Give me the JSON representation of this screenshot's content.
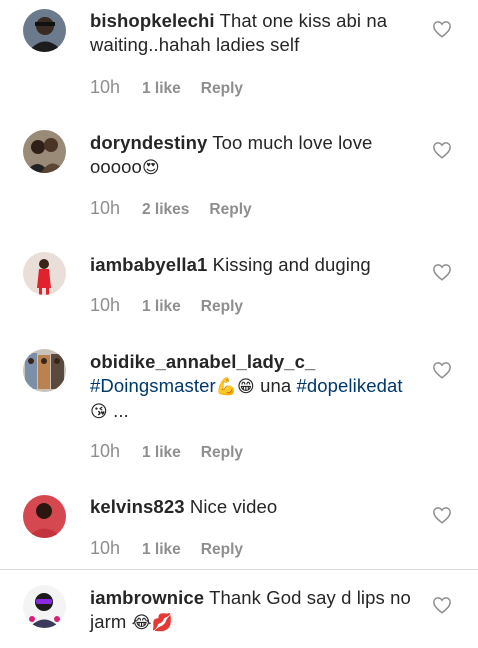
{
  "comments": [
    {
      "username": "bishopkelechi",
      "text": "That one kiss abi na waiting..hahah ladies self",
      "time": "10h",
      "likes": "1 like",
      "reply": "Reply"
    },
    {
      "username": "doryndestiny",
      "text": "Too much love love ooooo",
      "emoji": "😍",
      "time": "10h",
      "likes": "2 likes",
      "reply": "Reply"
    },
    {
      "username": "iambabyella1",
      "text": "Kissing and duging",
      "time": "10h",
      "likes": "1 like",
      "reply": "Reply"
    },
    {
      "username": "obidike_annabel_lady_c_",
      "hashtag1": "#Doingsmaster",
      "emoji1": "💪😁",
      "mid": "una",
      "hashtag2": "#dopelikedat",
      "emoji2": "😘",
      "trail": "...",
      "time": "10h",
      "likes": "1 like",
      "reply": "Reply"
    },
    {
      "username": "kelvins823",
      "text": "Nice video",
      "time": "10h",
      "likes": "1 like",
      "reply": "Reply"
    },
    {
      "username": "iambrownice",
      "text": "Thank God say d lips no jarm",
      "emoji": "😂💋",
      "time": "",
      "likes": "",
      "reply": ""
    }
  ],
  "icons": {
    "like": "heart-outline-icon"
  },
  "colors": {
    "text": "#262626",
    "meta": "#8e8e8e",
    "hashtag": "#00376b"
  }
}
